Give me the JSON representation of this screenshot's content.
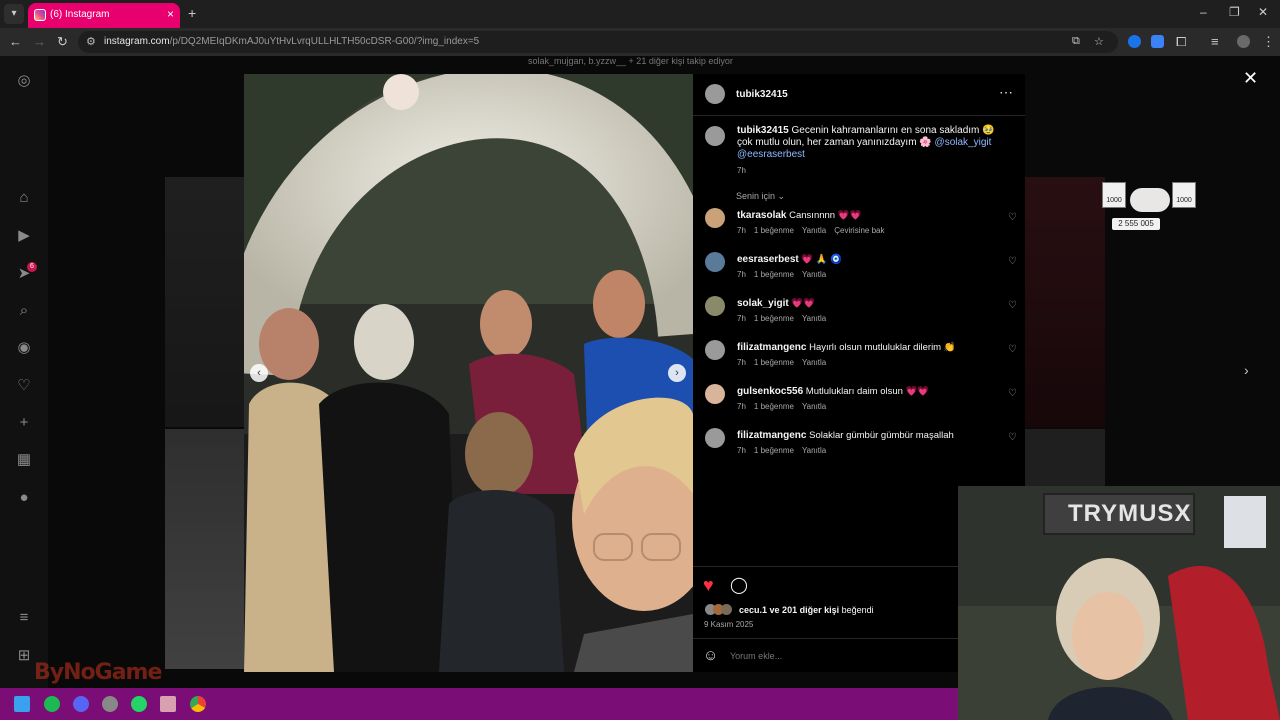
{
  "browser": {
    "tab_title": "(6) Instagram",
    "url_host": "instagram.com",
    "url_path": "/p/DQ2MEIqDKmAJ0uYtHvLvrqULLHLTH50cDSR-G00/?img_index=5"
  },
  "background": {
    "liked_by_strip": "solak_mujgan, b.yzzw__ + 21 diğer kişi takip ediyor"
  },
  "post": {
    "author": "tubik32415",
    "caption_text": "Gecenin kahramanlarını en sona sakladım 🥹 çok mutlu olun, her zaman yanınızdayım 🌸",
    "caption_mention_1": "@solak_yigit",
    "caption_mention_2": "@eesraserbest",
    "caption_time": "7h",
    "sort_label": "Senin için",
    "likes_text": "ve 201 diğer kişi",
    "likes_user": "cecu.1",
    "likes_suffix": "beğendi",
    "date": "9 Kasım 2025",
    "comment_placeholder": "Yorum ekle..."
  },
  "comments": [
    {
      "user": "tkarasolak",
      "text": "Cansınnnn 💗💗",
      "time": "7h",
      "likes": "1 beğenme",
      "reply": "Yanıtla",
      "extra": "Çevirisine bak"
    },
    {
      "user": "eesraserbest",
      "text": "💗 🙏 🧿",
      "time": "7h",
      "likes": "1 beğenme",
      "reply": "Yanıtla",
      "extra": ""
    },
    {
      "user": "solak_yigit",
      "text": "💗💗",
      "time": "7h",
      "likes": "1 beğenme",
      "reply": "Yanıtla",
      "extra": ""
    },
    {
      "user": "filizatmangenc",
      "text": "Hayırlı olsun mutluluklar dilerim 👏",
      "time": "7h",
      "likes": "1 beğenme",
      "reply": "Yanıtla",
      "extra": ""
    },
    {
      "user": "gulsenkoc556",
      "text": "Mutlulukları daim olsun 💗💗",
      "time": "7h",
      "likes": "1 beğenme",
      "reply": "Yanıtla",
      "extra": ""
    },
    {
      "user": "filizatmangenc",
      "text": "Solaklar gümbür gümbür maşallah",
      "time": "7h",
      "likes": "1 beğenme",
      "reply": "Yanıtla",
      "extra": ""
    }
  ],
  "overlay": {
    "watermark": "ByNoGame",
    "stream_count": "2 555 005",
    "badge_left": "1000",
    "badge_right": "1000",
    "webcam_sign": "TRYMUSX"
  },
  "colors": {
    "tab_active": "#e8006f",
    "taskbar": "#7a0d76",
    "like_red": "#ff3040",
    "mention_blue": "#8fb8ff"
  }
}
